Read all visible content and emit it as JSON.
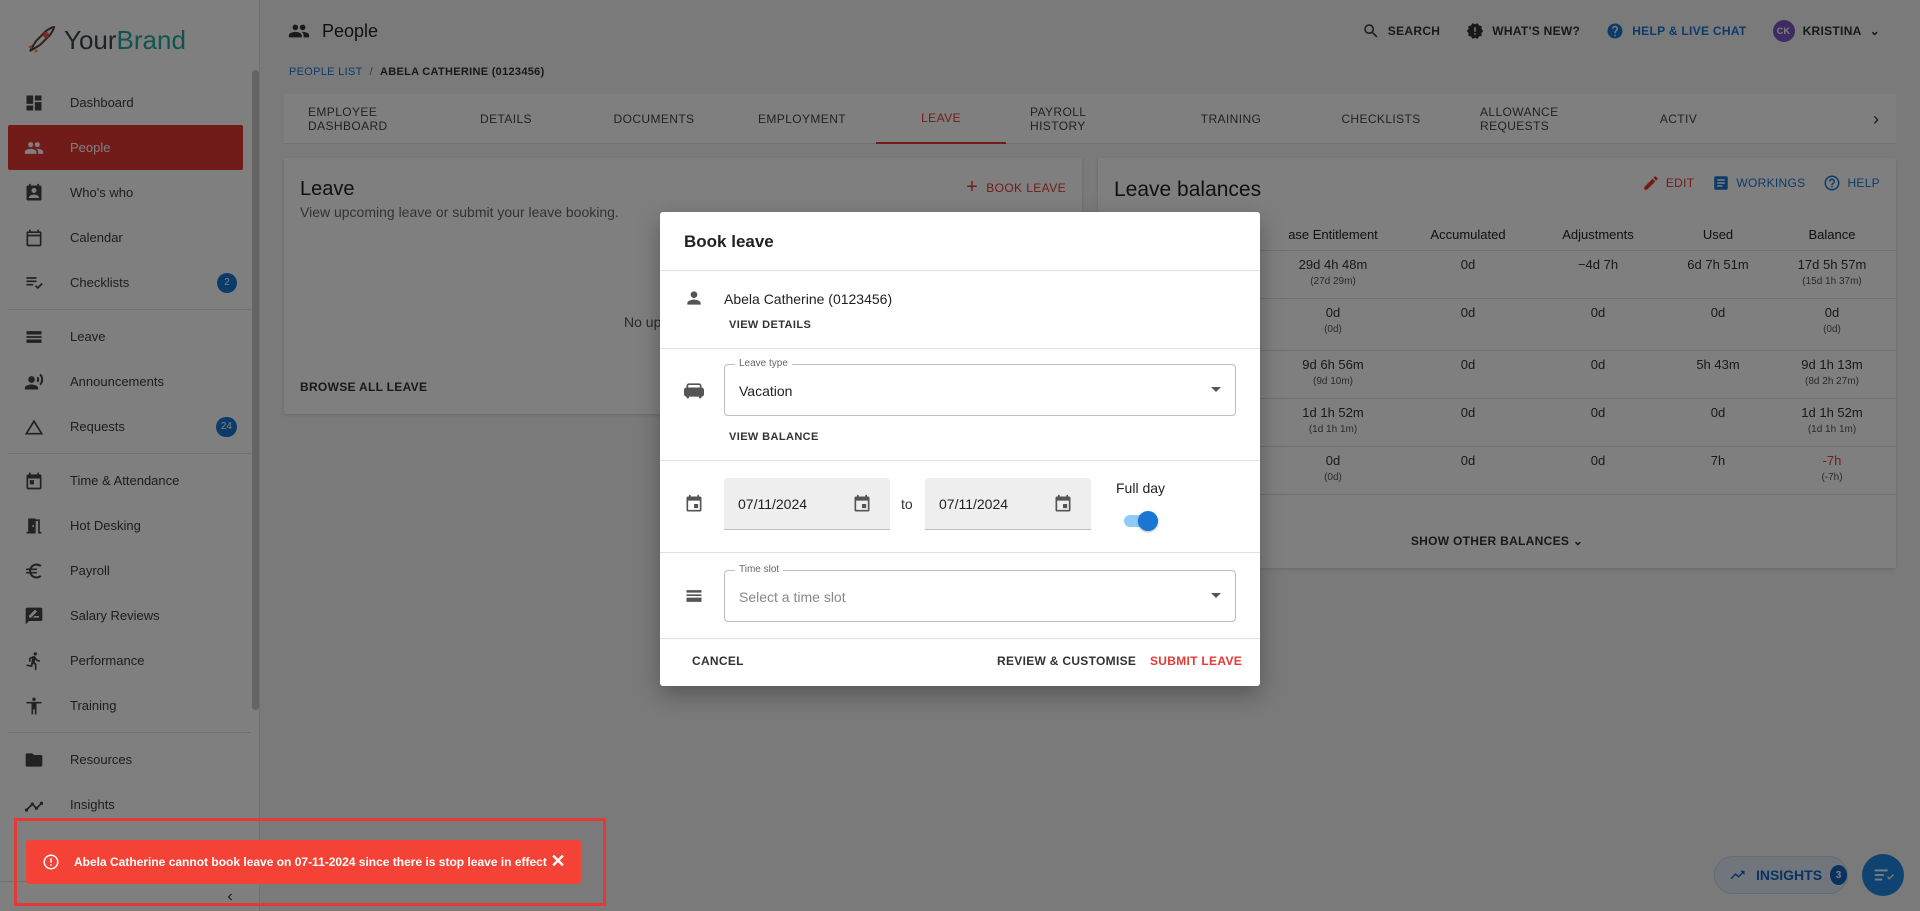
{
  "brand": {
    "name_part1": "Your",
    "name_part2": "Brand"
  },
  "sidebar": {
    "items": [
      {
        "label": "Dashboard",
        "icon": "dashboard-icon"
      },
      {
        "label": "People",
        "icon": "people-icon",
        "active": true
      },
      {
        "label": "Who's who",
        "icon": "badge-icon"
      },
      {
        "label": "Calendar",
        "icon": "calendar-icon"
      },
      {
        "label": "Checklists",
        "icon": "checklist-icon",
        "count": "2"
      },
      {
        "label": "Leave",
        "icon": "leave-icon"
      },
      {
        "label": "Announcements",
        "icon": "announcement-icon"
      },
      {
        "label": "Requests",
        "icon": "requests-icon",
        "count": "24"
      },
      {
        "label": "Time & Attendance",
        "icon": "time-icon"
      },
      {
        "label": "Hot Desking",
        "icon": "desk-icon"
      },
      {
        "label": "Payroll",
        "icon": "euro-icon"
      },
      {
        "label": "Salary Reviews",
        "icon": "review-icon"
      },
      {
        "label": "Performance",
        "icon": "performance-icon"
      },
      {
        "label": "Training",
        "icon": "training-icon"
      },
      {
        "label": "Resources",
        "icon": "folder-icon"
      },
      {
        "label": "Insights",
        "icon": "insights-icon"
      }
    ]
  },
  "header": {
    "title": "People",
    "search": "SEARCH",
    "whats_new": "WHAT'S NEW?",
    "help": "HELP & LIVE CHAT",
    "user_initials": "CK",
    "user_name": "KRISTINA"
  },
  "breadcrumb": {
    "link": "PEOPLE LIST",
    "sep": "/",
    "current": "ABELA CATHERINE (0123456)"
  },
  "tabs": [
    "EMPLOYEE DASHBOARD",
    "DETAILS",
    "DOCUMENTS",
    "EMPLOYMENT",
    "LEAVE",
    "PAYROLL HISTORY",
    "TRAINING",
    "CHECKLISTS",
    "ALLOWANCE REQUESTS",
    "ACTIV"
  ],
  "leave_card": {
    "title": "Leave",
    "subtitle": "View upcoming leave or submit your leave booking.",
    "book": "BOOK LEAVE",
    "empty": "No up",
    "browse": "BROWSE ALL LEAVE"
  },
  "balances": {
    "title": "Leave balances",
    "edit": "EDIT",
    "workings": "WORKINGS",
    "help": "HELP",
    "columns": [
      "ase Entitlement",
      "Accumulated",
      "Adjustments",
      "Used",
      "Balance"
    ],
    "rows": [
      {
        "ent": "29d 4h 48m",
        "ent_s": "(27d 29m)",
        "acc": "0d",
        "adj": "−4d 7h",
        "used": "6d 7h 51m",
        "bal": "17d 5h 57m",
        "bal_s": "(15d 1h 37m)"
      },
      {
        "ent": "0d",
        "ent_s": "(0d)",
        "acc": "0d",
        "adj": "0d",
        "used": "0d",
        "bal": "0d",
        "bal_s": "(0d)"
      },
      {
        "ent": "9d 6h 56m",
        "ent_s": "(9d 10m)",
        "acc": "0d",
        "adj": "0d",
        "used": "5h 43m",
        "bal": "9d 1h 13m",
        "bal_s": "(8d 2h 27m)"
      },
      {
        "ent": "1d 1h 52m",
        "ent_s": "(1d 1h 1m)",
        "acc": "0d",
        "adj": "0d",
        "used": "0d",
        "bal": "1d 1h 52m",
        "bal_s": "(1d 1h 1m)"
      },
      {
        "ent": "0d",
        "ent_s": "(0d)",
        "acc": "0d",
        "adj": "0d",
        "used": "7h",
        "bal": "-7h",
        "bal_s": "(-7h)",
        "negative": true
      }
    ],
    "show_other": "SHOW OTHER BALANCES"
  },
  "dialog": {
    "title": "Book leave",
    "person": "Abela Catherine (0123456)",
    "view_details": "VIEW DETAILS",
    "leave_type_label": "Leave type",
    "leave_type_value": "Vacation",
    "view_balance": "VIEW BALANCE",
    "date_from": "07/11/2024",
    "to": "to",
    "date_to": "07/11/2024",
    "full_day_label": "Full day",
    "full_day_on": true,
    "time_slot_label": "Time slot",
    "time_slot_placeholder": "Select a time slot",
    "cancel": "CANCEL",
    "review": "REVIEW & CUSTOMISE",
    "submit": "SUBMIT LEAVE"
  },
  "snackbar": {
    "message": "Abela Catherine cannot book leave on 07-11-2024 since there is stop leave in effect",
    "close": "✕"
  },
  "insights_fab": {
    "label": "INSIGHTS",
    "count": "3"
  },
  "colors": {
    "accent": "#e53935",
    "link": "#1976d2",
    "brand_teal": "#26a69a"
  }
}
